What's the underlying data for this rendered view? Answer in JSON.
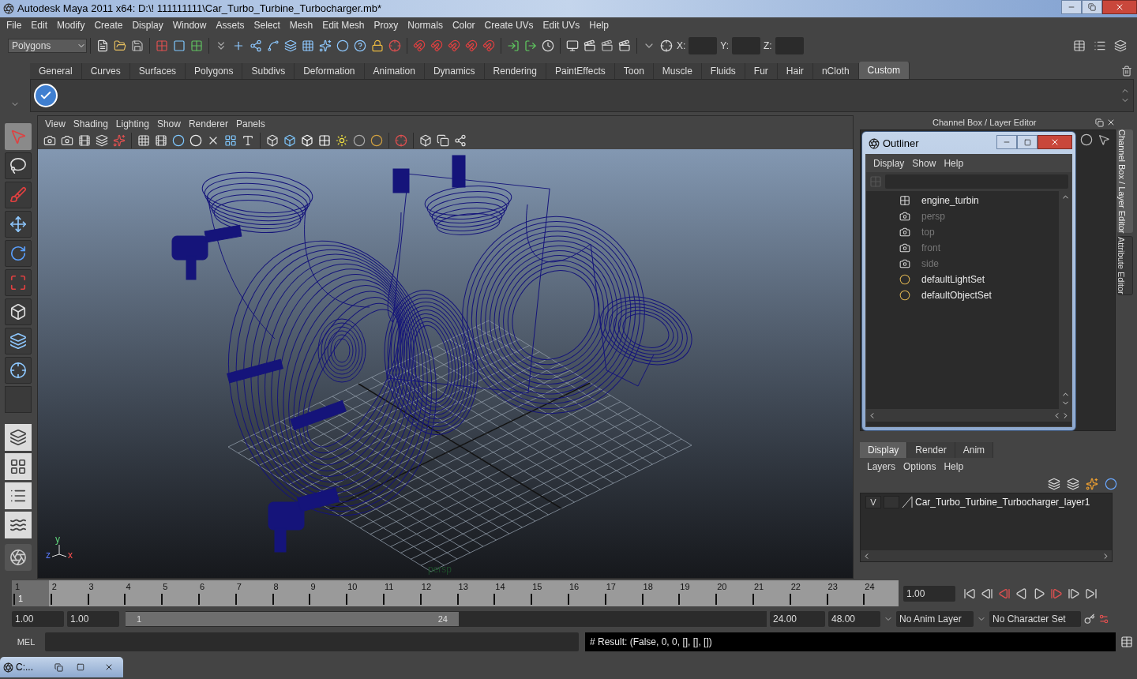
{
  "window": {
    "title": "Autodesk Maya 2011 x64: D:\\! 111111111\\Car_Turbo_Turbine_Turbocharger.mb*"
  },
  "menu_bar": [
    "File",
    "Edit",
    "Modify",
    "Create",
    "Display",
    "Window",
    "Assets",
    "Select",
    "Mesh",
    "Edit Mesh",
    "Proxy",
    "Normals",
    "Color",
    "Create UVs",
    "Edit UVs",
    "Help"
  ],
  "toolbar": {
    "mode": "Polygons",
    "coords": [
      "X:",
      "Y:",
      "Z:"
    ]
  },
  "shelf": {
    "tabs": [
      {
        "label": "General",
        "selected": false
      },
      {
        "label": "Curves",
        "selected": false
      },
      {
        "label": "Surfaces",
        "selected": false
      },
      {
        "label": "Polygons",
        "selected": false
      },
      {
        "label": "Subdivs",
        "selected": false
      },
      {
        "label": "Deformation",
        "selected": false
      },
      {
        "label": "Animation",
        "selected": false
      },
      {
        "label": "Dynamics",
        "selected": false
      },
      {
        "label": "Rendering",
        "selected": false
      },
      {
        "label": "PaintEffects",
        "selected": false
      },
      {
        "label": "Toon",
        "selected": false
      },
      {
        "label": "Muscle",
        "selected": false
      },
      {
        "label": "Fluids",
        "selected": false
      },
      {
        "label": "Fur",
        "selected": false
      },
      {
        "label": "Hair",
        "selected": false
      },
      {
        "label": "nCloth",
        "selected": false
      },
      {
        "label": "Custom",
        "selected": true
      }
    ]
  },
  "viewport": {
    "menus": [
      "View",
      "Shading",
      "Lighting",
      "Show",
      "Renderer",
      "Panels"
    ],
    "axis": {
      "y": "y",
      "z": "z",
      "x": "x"
    },
    "camera_label": "persp"
  },
  "channel_box": {
    "title": "Channel Box / Layer Editor",
    "side_tabs": [
      {
        "label": "Channel Box / Layer Editor",
        "selected": true
      },
      {
        "label": "Attribute Editor",
        "selected": false
      }
    ]
  },
  "outliner": {
    "title": "Outliner",
    "menus": [
      "Display",
      "Show",
      "Help"
    ],
    "items": [
      {
        "kind": "mesh",
        "label": "engine_turbin",
        "dimmed": false
      },
      {
        "kind": "camera",
        "label": "persp",
        "dimmed": true
      },
      {
        "kind": "camera",
        "label": "top",
        "dimmed": true
      },
      {
        "kind": "camera",
        "label": "front",
        "dimmed": true
      },
      {
        "kind": "camera",
        "label": "side",
        "dimmed": true
      },
      {
        "kind": "set",
        "label": "defaultLightSet",
        "dimmed": false
      },
      {
        "kind": "set",
        "label": "defaultObjectSet",
        "dimmed": false
      }
    ]
  },
  "layer_editor": {
    "tabs": [
      {
        "label": "Display",
        "selected": true
      },
      {
        "label": "Render",
        "selected": false
      },
      {
        "label": "Anim",
        "selected": false
      }
    ],
    "menus": [
      "Layers",
      "Options",
      "Help"
    ],
    "layers": [
      {
        "visibility": "V",
        "name": "Car_Turbo_Turbine_Turbocharger_layer1"
      }
    ]
  },
  "time_slider": {
    "ticks": [
      {
        "label": "1",
        "selected": true
      },
      {
        "label": "2",
        "selected": false
      },
      {
        "label": "3",
        "selected": false
      },
      {
        "label": "4",
        "selected": false
      },
      {
        "label": "5",
        "selected": false
      },
      {
        "label": "6",
        "selected": false
      },
      {
        "label": "7",
        "selected": false
      },
      {
        "label": "8",
        "selected": false
      },
      {
        "label": "9",
        "selected": false
      },
      {
        "label": "10",
        "selected": false
      },
      {
        "label": "11",
        "selected": false
      },
      {
        "label": "12",
        "selected": false
      },
      {
        "label": "13",
        "selected": false
      },
      {
        "label": "14",
        "selected": false
      },
      {
        "label": "15",
        "selected": false
      },
      {
        "label": "16",
        "selected": false
      },
      {
        "label": "17",
        "selected": false
      },
      {
        "label": "18",
        "selected": false
      },
      {
        "label": "19",
        "selected": false
      },
      {
        "label": "20",
        "selected": false
      },
      {
        "label": "21",
        "selected": false
      },
      {
        "label": "22",
        "selected": false
      },
      {
        "label": "23",
        "selected": false
      },
      {
        "label": "24",
        "selected": false
      }
    ],
    "current_frame": "1",
    "current_time": "1.00"
  },
  "range_slider": {
    "start_time": "1.00",
    "playback_start": "1.00",
    "range_start": "1",
    "range_end": "24",
    "playback_end": "24.00",
    "end_time": "48.00",
    "anim_layer": "No Anim Layer",
    "character_set": "No Character Set"
  },
  "command_line": {
    "label": "MEL",
    "result": "# Result: (False, 0, 0, [], [], [])"
  },
  "minimized_window": {
    "title": "C:..."
  }
}
